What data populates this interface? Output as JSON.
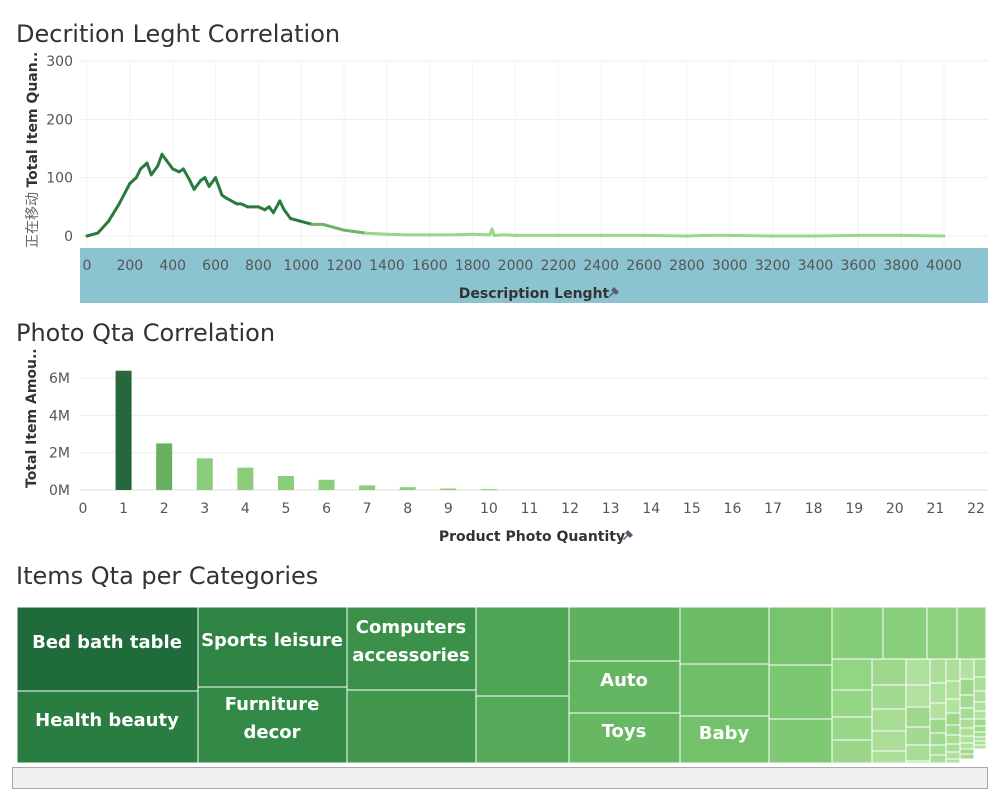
{
  "titles": {
    "chart1": "Decrition Leght Correlation",
    "chart2": "Photo Qta Correlation",
    "chart3": "Items Qta per Categories"
  },
  "colors": {
    "dark_green": "#1f6b3a",
    "mid_green": "#4ea556",
    "light_green": "#9bd58a",
    "highlight_axis": "#8bc3d1",
    "pin": "#555f6e"
  },
  "chart_data": [
    {
      "type": "line",
      "title": "Decrition Leght Correlation",
      "xlabel": "Description Lenght",
      "xlabel_icon": "pin-icon",
      "ylabel_prefix": "正在移动",
      "ylabel": "Total Item Quan..",
      "xlim": [
        0,
        4000
      ],
      "ylim": [
        0,
        300
      ],
      "x_ticks": [
        "0",
        "200",
        "400",
        "600",
        "800",
        "1000",
        "1200",
        "1400",
        "1600",
        "1800",
        "2000",
        "2200",
        "2400",
        "2600",
        "2800",
        "3000",
        "3200",
        "3400",
        "3600",
        "3800",
        "4000"
      ],
      "y_ticks": [
        "0",
        "100",
        "200",
        "300"
      ],
      "x_axis_highlighted": true,
      "series": [
        {
          "x": [
            0,
            50,
            100,
            150,
            200,
            230,
            250,
            280,
            300,
            330,
            350,
            370,
            400,
            430,
            450,
            480,
            500,
            530,
            550,
            570,
            600,
            630,
            650,
            700,
            720,
            750,
            800,
            830,
            850,
            870,
            900,
            920,
            950,
            1000,
            1050,
            1100,
            1150,
            1200,
            1300,
            1400,
            1500,
            1600,
            1700,
            1800,
            1880,
            1890,
            1900,
            1950,
            2000,
            2200,
            2400,
            2600,
            2800,
            2900,
            3000,
            3200,
            3400,
            3600,
            3800,
            4000
          ],
          "y": [
            0,
            5,
            25,
            55,
            90,
            100,
            115,
            125,
            105,
            120,
            140,
            130,
            115,
            110,
            115,
            95,
            80,
            95,
            100,
            85,
            100,
            70,
            65,
            55,
            55,
            50,
            50,
            45,
            50,
            40,
            60,
            45,
            30,
            25,
            20,
            20,
            15,
            10,
            5,
            3,
            2,
            2,
            2,
            3,
            2,
            12,
            1,
            2,
            1,
            1,
            1,
            1,
            0,
            1,
            1,
            0,
            0,
            1,
            1,
            0
          ]
        }
      ]
    },
    {
      "type": "bar",
      "title": "Photo Qta Correlation",
      "xlabel": "Product Photo Quantity",
      "xlabel_icon": "pin-icon",
      "ylabel": "Total Item Amou..",
      "categories": [
        "0",
        "1",
        "2",
        "3",
        "4",
        "5",
        "6",
        "7",
        "8",
        "9",
        "10",
        "11",
        "12",
        "13",
        "14",
        "15",
        "16",
        "17",
        "18",
        "19",
        "20",
        "21",
        "22"
      ],
      "values": [
        0,
        6.4,
        2.5,
        1.7,
        1.2,
        0.75,
        0.55,
        0.25,
        0.15,
        0.08,
        0.05,
        0,
        0,
        0,
        0,
        0,
        0,
        0,
        0,
        0,
        0,
        0,
        0
      ],
      "y_ticks": [
        "0M",
        "2M",
        "4M",
        "6M"
      ],
      "ylim": [
        0,
        6.6
      ]
    },
    {
      "type": "treemap",
      "title": "Items Qta per Categories",
      "labels": [
        "Bed bath table",
        "Sports leisure",
        "Computers accessories",
        "Health beauty",
        "Furniture decor",
        "Auto",
        "Toys",
        "Baby"
      ]
    }
  ]
}
